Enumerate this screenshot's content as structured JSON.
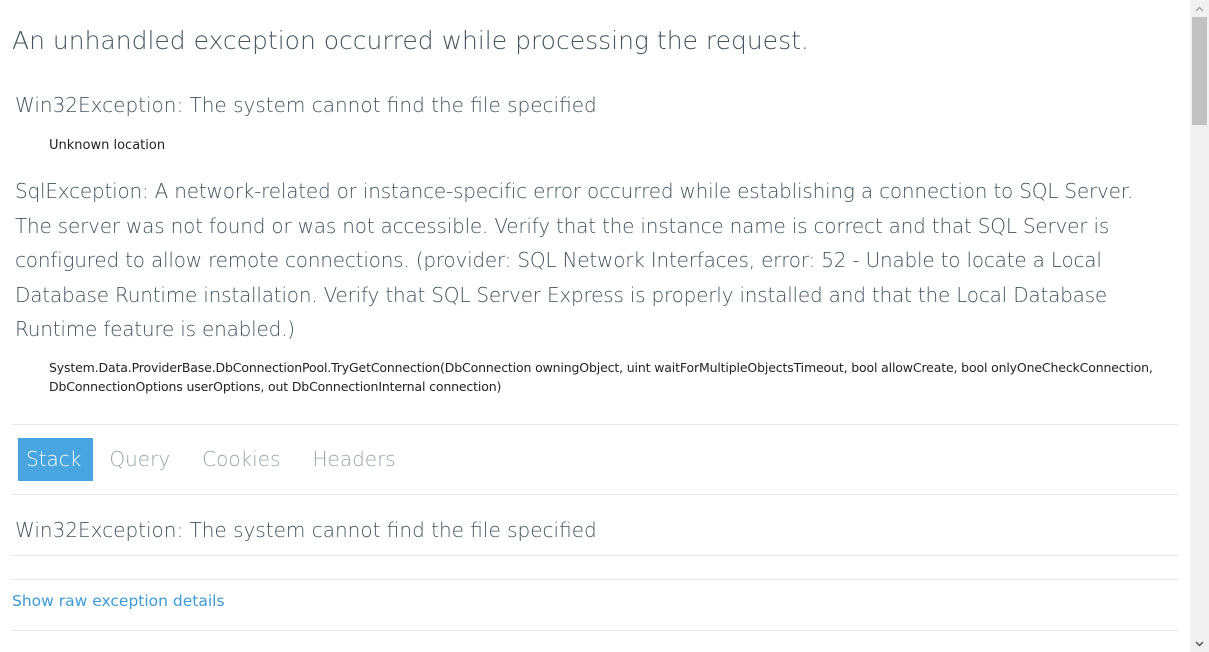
{
  "header": {
    "title": "An unhandled exception occurred while processing the request."
  },
  "exceptions": [
    {
      "title": "Win32Exception: The system cannot find the file specified",
      "location": "Unknown location"
    },
    {
      "title": "SqlException: A network-related or instance-specific error occurred while establishing a connection to SQL Server. The server was not found or was not accessible. Verify that the instance name is correct and that SQL Server is configured to allow remote connections. (provider: SQL Network Interfaces, error: 52 - Unable to locate a Local Database Runtime installation. Verify that SQL Server Express is properly installed and that the Local Database Runtime feature is enabled.)",
      "location": "System.Data.ProviderBase.DbConnectionPool.TryGetConnection(DbConnection owningObject, uint waitForMultipleObjectsTimeout, bool allowCreate, bool onlyOneCheckConnection, DbConnectionOptions userOptions, out DbConnectionInternal connection)"
    }
  ],
  "tabs": [
    {
      "label": "Stack",
      "active": true
    },
    {
      "label": "Query",
      "active": false
    },
    {
      "label": "Cookies",
      "active": false
    },
    {
      "label": "Headers",
      "active": false
    }
  ],
  "stack_panel": {
    "exception_title": "Win32Exception: The system cannot find the file specified"
  },
  "raw_link": {
    "label": "Show raw exception details"
  },
  "colors": {
    "accent": "#48a5e0",
    "link": "#3c9ad8",
    "heading": "#44525e",
    "tab_inactive": "#9aa3aa"
  },
  "icons": {
    "scroll_up": "chevron-up-icon",
    "scroll_down": "chevron-down-icon"
  }
}
